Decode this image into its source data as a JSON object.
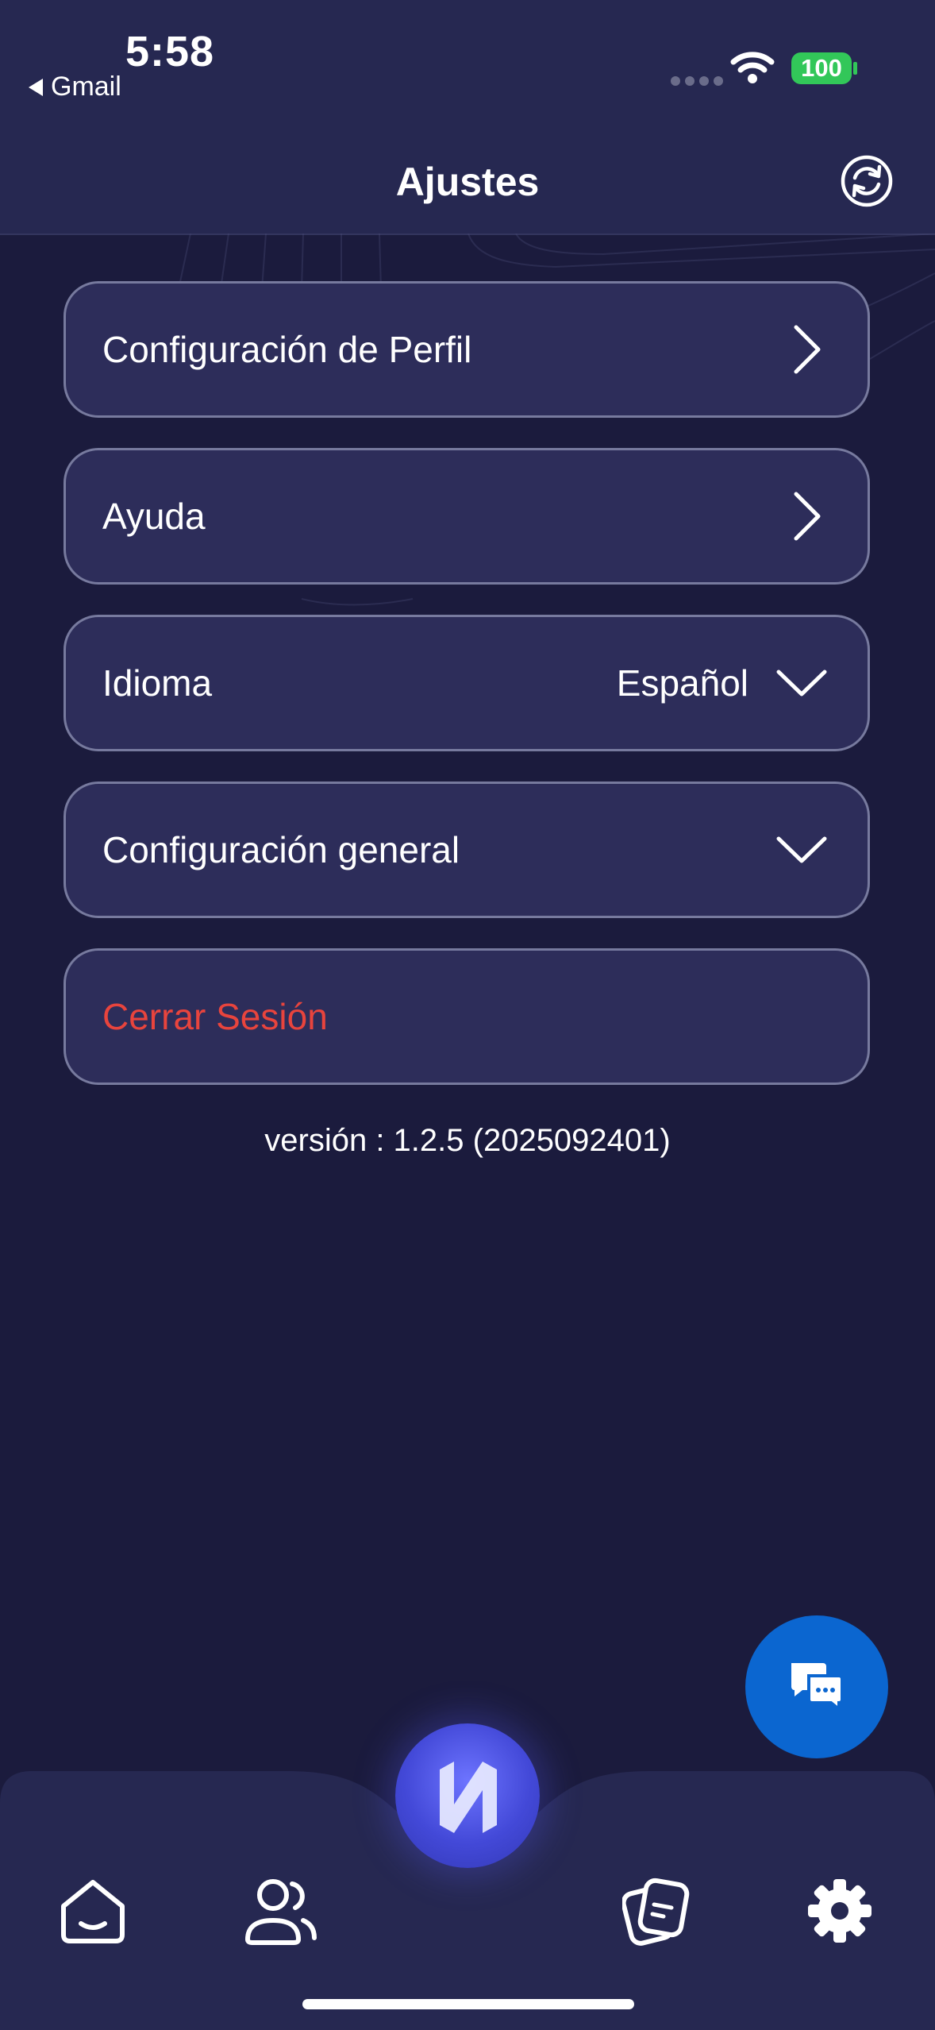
{
  "status_bar": {
    "time": "5:58",
    "back_app": "Gmail",
    "battery": "100",
    "battery_color": "#32c759"
  },
  "header": {
    "title": "Ajustes",
    "sync_icon": "sync-icon"
  },
  "settings": {
    "profile_label": "Configuración de Perfil",
    "help_label": "Ayuda",
    "language_label": "Idioma",
    "language_value": "Español",
    "general_label": "Configuración general",
    "logout_label": "Cerrar Sesión"
  },
  "version": "versión : 1.2.5 (2025092401)",
  "colors": {
    "background": "#1b1b3d",
    "card": "#2d2d5a",
    "danger": "#e8443d",
    "fab": "#0b66d0"
  },
  "tabbar": {
    "items": [
      {
        "icon": "home-icon"
      },
      {
        "icon": "users-icon"
      },
      {
        "icon": "logo-icon"
      },
      {
        "icon": "cards-icon"
      },
      {
        "icon": "gear-icon"
      }
    ],
    "active": "gear-icon"
  },
  "fab": {
    "icon": "chat-icon"
  }
}
